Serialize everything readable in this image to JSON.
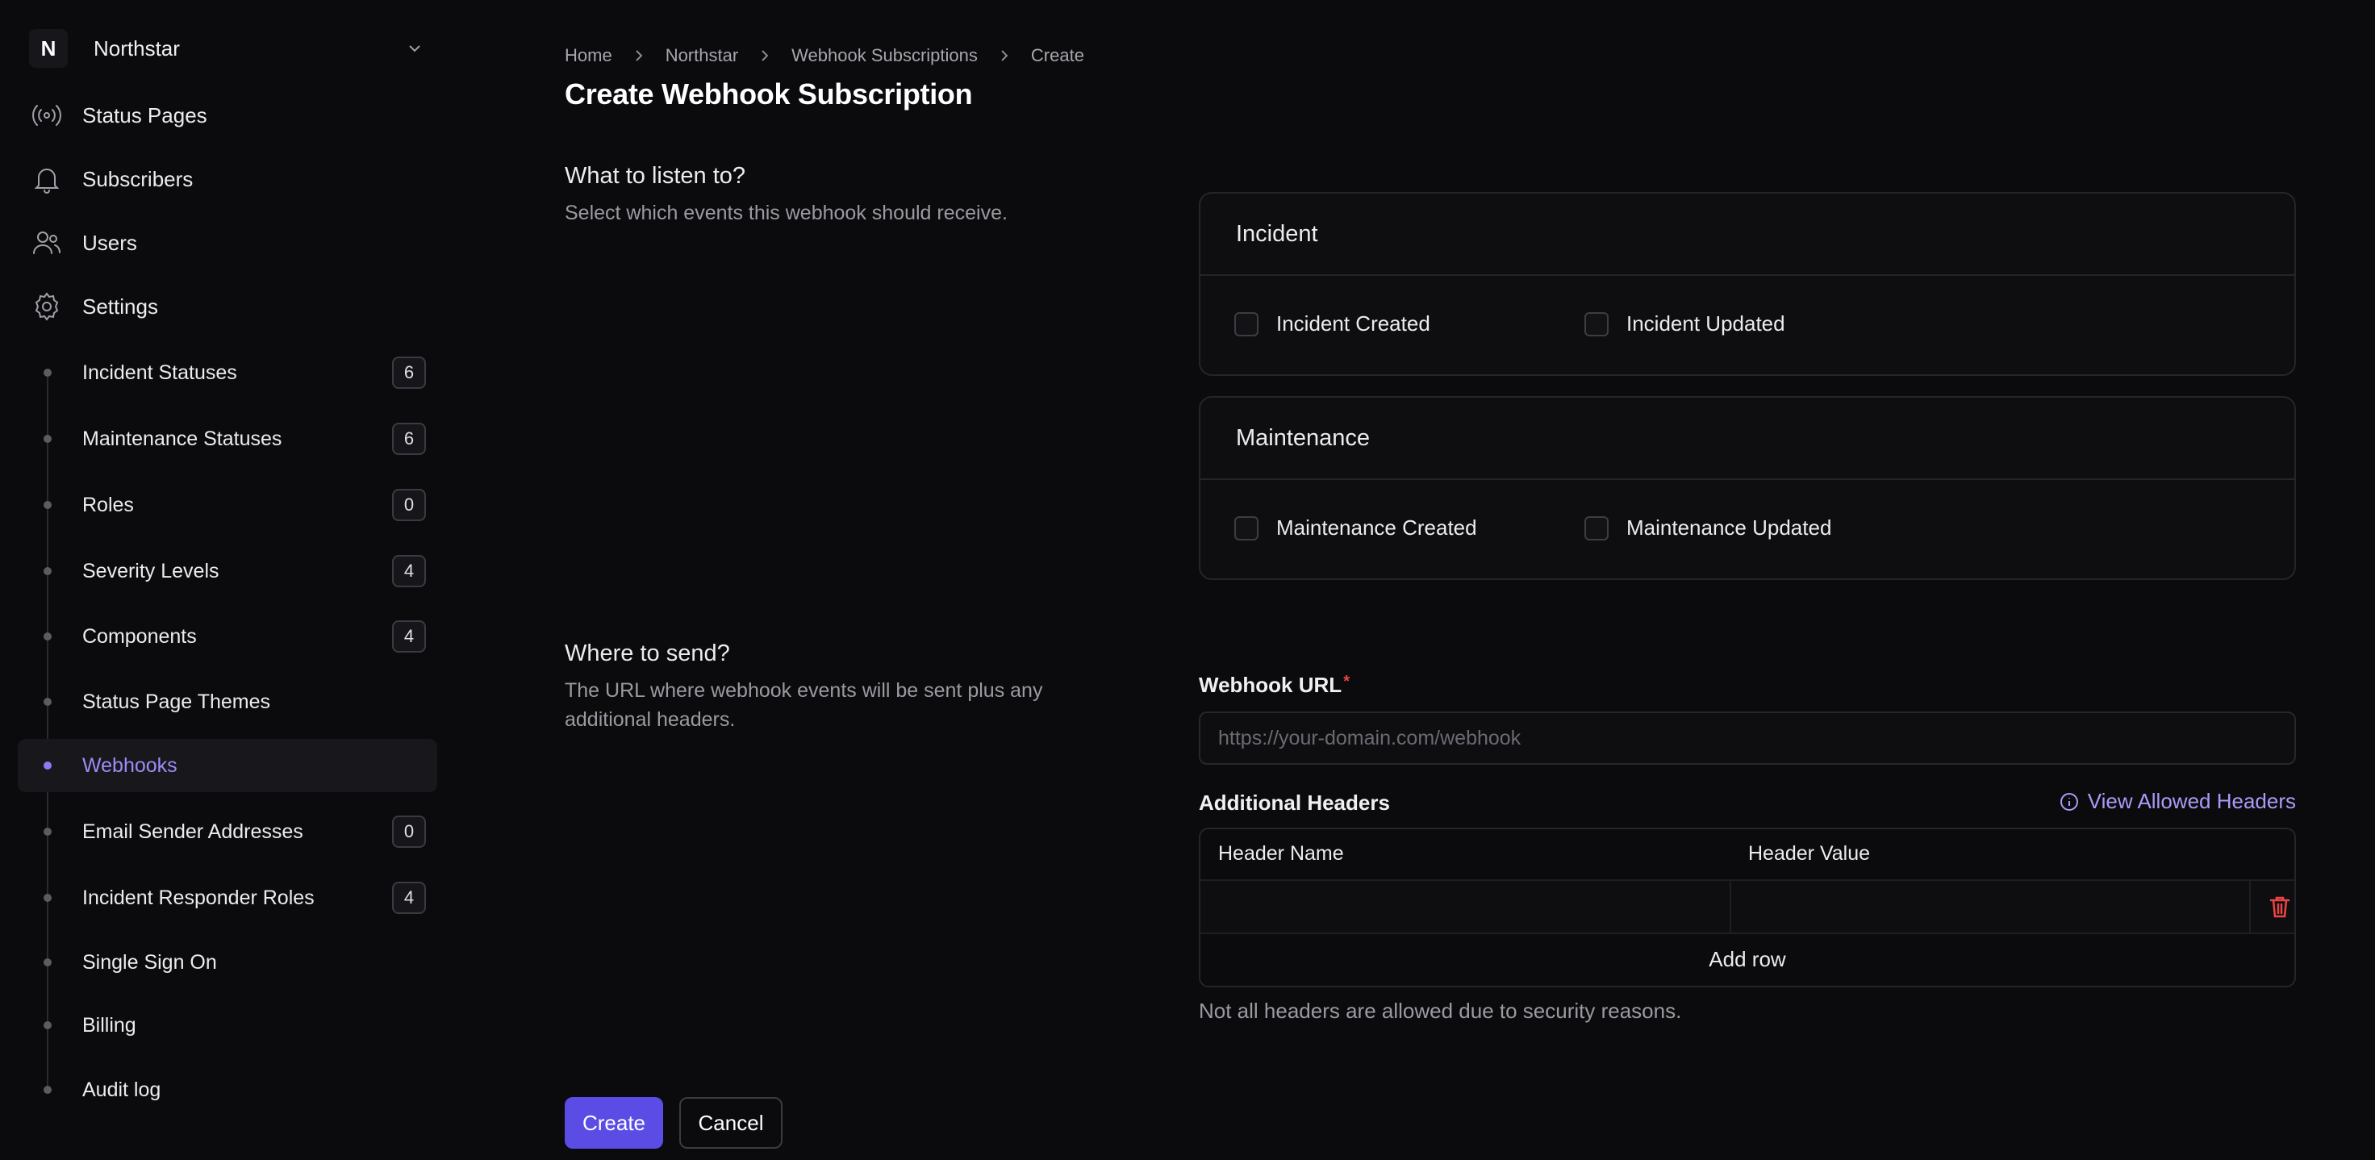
{
  "workspace": {
    "initial": "N",
    "name": "Northstar"
  },
  "nav": [
    {
      "label": "Status Pages",
      "icon": "broadcast-icon"
    },
    {
      "label": "Subscribers",
      "icon": "bell-icon"
    },
    {
      "label": "Users",
      "icon": "users-icon"
    },
    {
      "label": "Settings",
      "icon": "gear-icon"
    }
  ],
  "settings_items": [
    {
      "label": "Incident Statuses",
      "count": "6"
    },
    {
      "label": "Maintenance Statuses",
      "count": "6"
    },
    {
      "label": "Roles",
      "count": "0"
    },
    {
      "label": "Severity Levels",
      "count": "4"
    },
    {
      "label": "Components",
      "count": "4"
    },
    {
      "label": "Status Page Themes"
    },
    {
      "label": "Webhooks",
      "active": true
    },
    {
      "label": "Email Sender Addresses",
      "count": "0"
    },
    {
      "label": "Incident Responder Roles",
      "count": "4"
    },
    {
      "label": "Single Sign On"
    },
    {
      "label": "Billing"
    },
    {
      "label": "Audit log"
    }
  ],
  "breadcrumb": [
    "Home",
    "Northstar",
    "Webhook Subscriptions",
    "Create"
  ],
  "page_title": "Create Webhook Subscription",
  "listen": {
    "title": "What to listen to?",
    "description": "Select which events this webhook should receive.",
    "incident": {
      "title": "Incident",
      "created": "Incident Created",
      "updated": "Incident Updated"
    },
    "maintenance": {
      "title": "Maintenance",
      "created": "Maintenance Created",
      "updated": "Maintenance Updated"
    }
  },
  "send": {
    "title": "Where to send?",
    "description": "The URL where webhook events will be sent plus any additional headers.",
    "url_label": "Webhook URL",
    "url_required": "*",
    "url_placeholder": "https://your-domain.com/webhook",
    "headers_label": "Additional Headers",
    "view_headers": "View Allowed Headers",
    "col_name": "Header Name",
    "col_value": "Header Value",
    "add_row": "Add row",
    "note": "Not all headers are allowed due to security reasons."
  },
  "actions": {
    "create": "Create",
    "cancel": "Cancel"
  },
  "colors": {
    "accent": "#5b4ce6",
    "active_text": "#9d8cf7",
    "danger": "#ef4444"
  }
}
